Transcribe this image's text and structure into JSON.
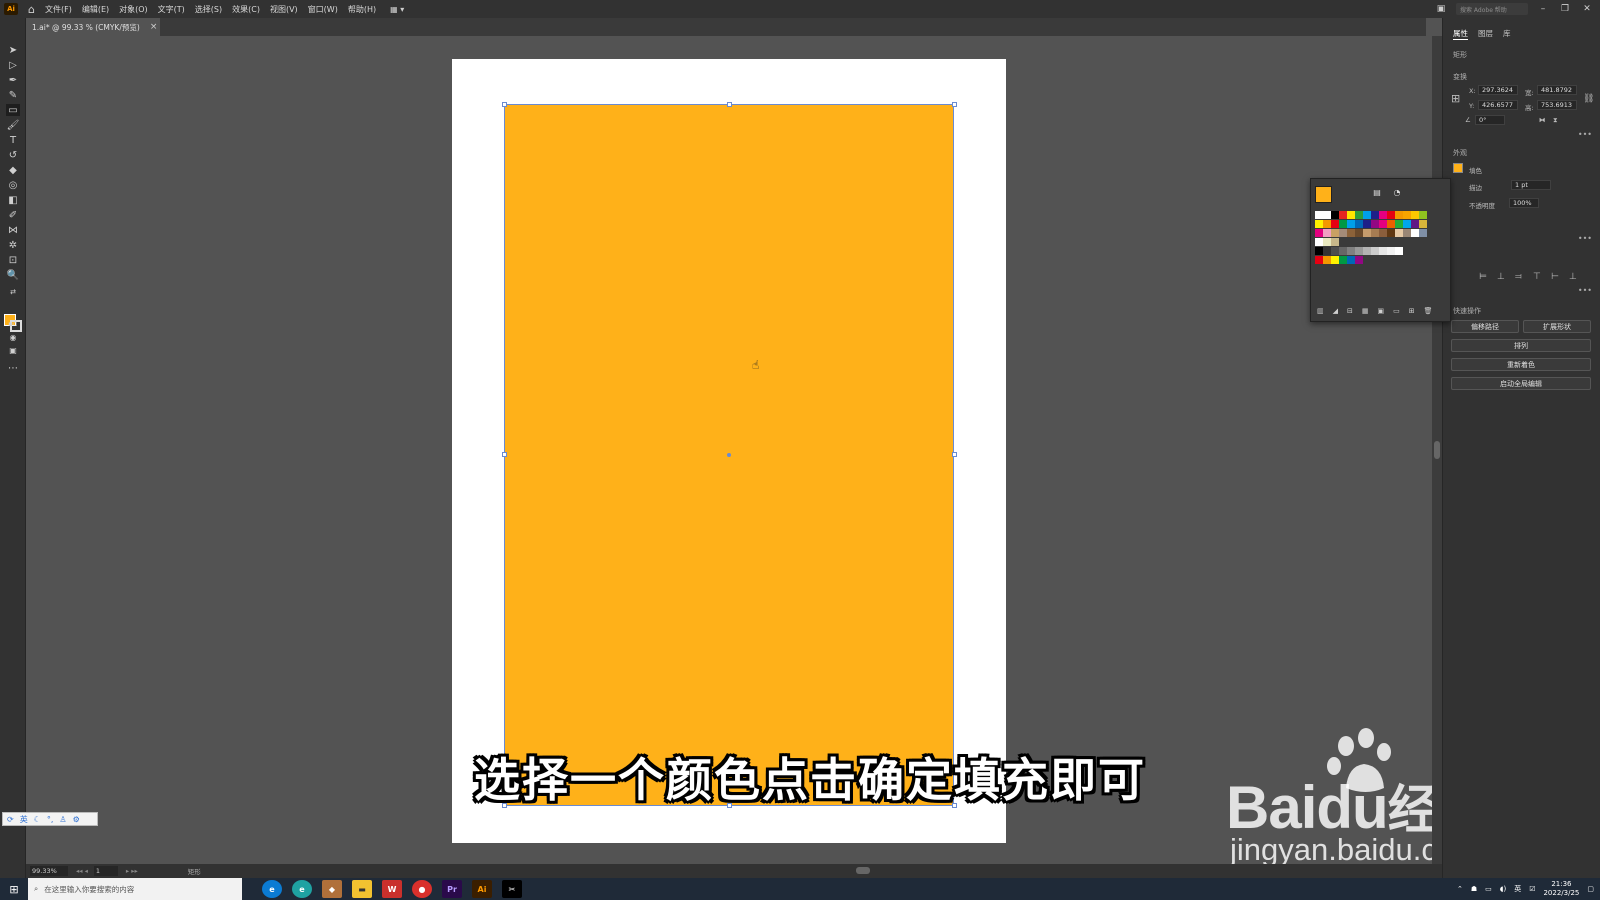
{
  "menubar": {
    "logo": "Ai",
    "items": [
      "文件(F)",
      "编辑(E)",
      "对象(O)",
      "文字(T)",
      "选择(S)",
      "效果(C)",
      "视图(V)",
      "窗口(W)",
      "帮助(H)"
    ],
    "search_placeholder": "搜索 Adobe 帮助"
  },
  "document_tab": {
    "title": "1.ai* @ 99.33 % (CMYK/预览)",
    "close": "×"
  },
  "subtitle": "选择一个颜色点击确定填充即可",
  "watermark": {
    "brand_latin": "Bai",
    "brand_du": "du",
    "brand_cn": "经验",
    "url": "jingyan.baidu.com"
  },
  "properties_panel": {
    "tabs": [
      "属性",
      "图层",
      "库"
    ],
    "object_type": "矩形",
    "transform_label": "变换",
    "x_label": "X:",
    "x_value": "297.3624",
    "y_label": "Y:",
    "y_value": "426.6577",
    "w_label": "宽:",
    "w_value": "481.8792",
    "h_label": "高:",
    "h_value": "753.6913",
    "angle_value": "0°",
    "appearance_label": "外观",
    "fill_label": "填色",
    "stroke_label": "描边",
    "stroke_value": "1 pt",
    "opacity_label": "不透明度",
    "opacity_value": "100%",
    "quick_actions_label": "快速操作",
    "buttons": {
      "offset_path": "偏移路径",
      "expand_shape": "扩展形状",
      "arrange": "排列",
      "recolor": "重新着色",
      "global_edit": "启动全局编辑"
    }
  },
  "fill_color": "#ffb119",
  "swatches": {
    "rows": [
      [
        "#ffffff",
        "#ffffff",
        "#000000",
        "#e52521",
        "#ffe500",
        "#2e9d3a",
        "#00a0e9",
        "#1d2088",
        "#e4007f",
        "#e60012",
        "#f39800",
        "#f7a400",
        "#fcc800",
        "#8fc31f"
      ],
      [
        "#fff100",
        "#f39800",
        "#e60012",
        "#009944",
        "#00a0e9",
        "#0068b7",
        "#1d2088",
        "#920783",
        "#e4007f",
        "#eb6100",
        "#22ac38",
        "#00a7eb",
        "#601986",
        "#d8b53a"
      ],
      [
        "#e4007f",
        "#f19ec2",
        "#c9a063",
        "#a48b78",
        "#8c6239",
        "#6b4a2b",
        "#c69c6d",
        "#a67c52",
        "#8b5e3c",
        "#603813",
        "#e6c9a5",
        "#998675",
        "#ffffff",
        "#7f8fa6"
      ],
      [
        "#ffffff",
        "#e8e8c0",
        "#c8b88a"
      ],
      [
        "#000000",
        "#333333",
        "#4d4d4d",
        "#666666",
        "#808080",
        "#999999",
        "#b3b3b3",
        "#cccccc",
        "#e6e6e6",
        "#f2f2f2",
        "#ffffff"
      ],
      [
        "#e60012",
        "#f39800",
        "#fff100",
        "#009944",
        "#0068b7",
        "#920783"
      ]
    ]
  },
  "statusbar": {
    "zoom": "99.33%",
    "page": "1",
    "tool": "矩形"
  },
  "taskbar": {
    "search_placeholder": "在这里输入你要搜索的内容",
    "ime": "英",
    "time": "21:36",
    "date": "2022/3/25"
  }
}
